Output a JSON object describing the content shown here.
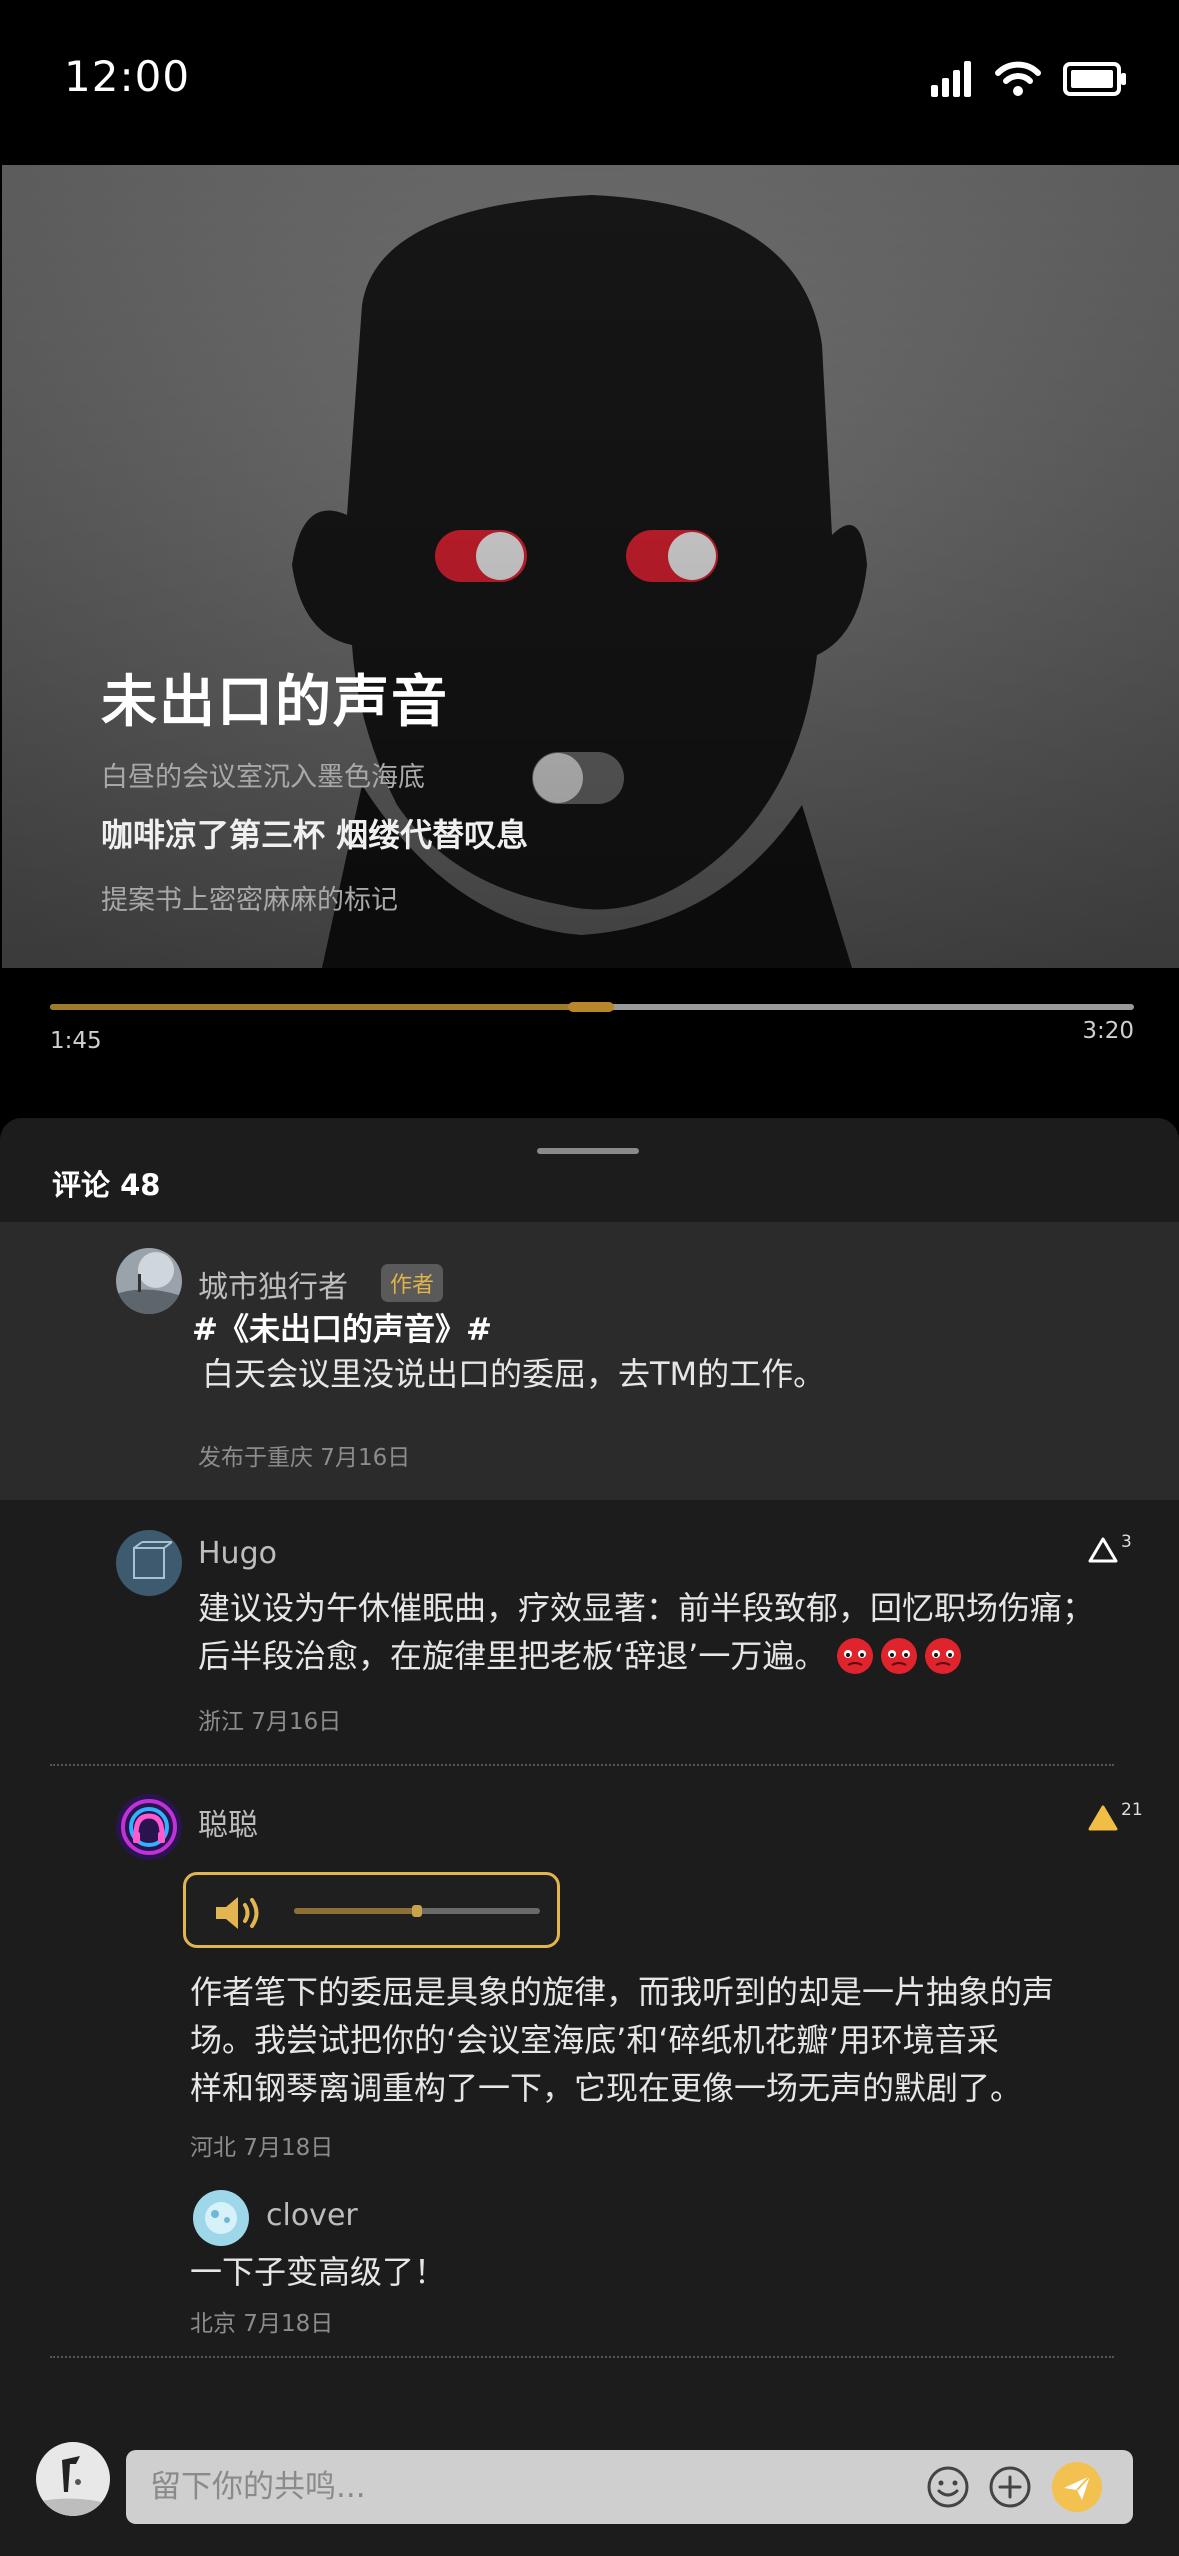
{
  "status_bar": {
    "time": "12:00"
  },
  "player": {
    "title": "未出口的声音",
    "lyrics": {
      "previous": "白昼的会议室沉入墨色海底",
      "current": "咖啡凉了第三杯 烟缕代替叹息",
      "next": "提案书上密密麻麻的标记"
    },
    "progress": {
      "current_time": "1:45",
      "total_time": "3:20",
      "fraction": 0.52
    }
  },
  "comments": {
    "header": "评论 48",
    "author_post": {
      "name": "城市独行者",
      "badge": "作者",
      "topic": "#《未出口的声音》#",
      "text": "白天会议里没说出口的委屈，去TM的工作。",
      "meta": "发布于重庆  7月16日"
    },
    "items": [
      {
        "name": "Hugo",
        "likes": "3",
        "text_line1": "建议设为午休催眠曲，疗效显著：前半段致郁，回忆职场伤痛；",
        "text_line2": "后半段治愈，在旋律里把老板‘辞退’一万遍。",
        "meta": "浙江  7月16日"
      },
      {
        "name": "聪聪",
        "likes": "21",
        "voice_progress": 0.5,
        "text_line1": "作者笔下的委屈是具象的旋律，而我听到的却是一片抽象的声",
        "text_line2": "场。我尝试把你的‘会议室海底’和‘碎纸机花瓣’用环境音采",
        "text_line3": "样和钢琴离调重构了一下，它现在更像一场无声的默剧了。",
        "meta": "河北  7月18日",
        "reply": {
          "name": "clover",
          "text": "一下子变高级了！",
          "meta": "北京  7月18日"
        }
      }
    ]
  },
  "composer": {
    "placeholder": "留下你的共鸣..."
  },
  "colors": {
    "accent": "#e2b550",
    "sheet_bg": "#1c1c1c",
    "author_card_bg": "#2b2b2b"
  }
}
